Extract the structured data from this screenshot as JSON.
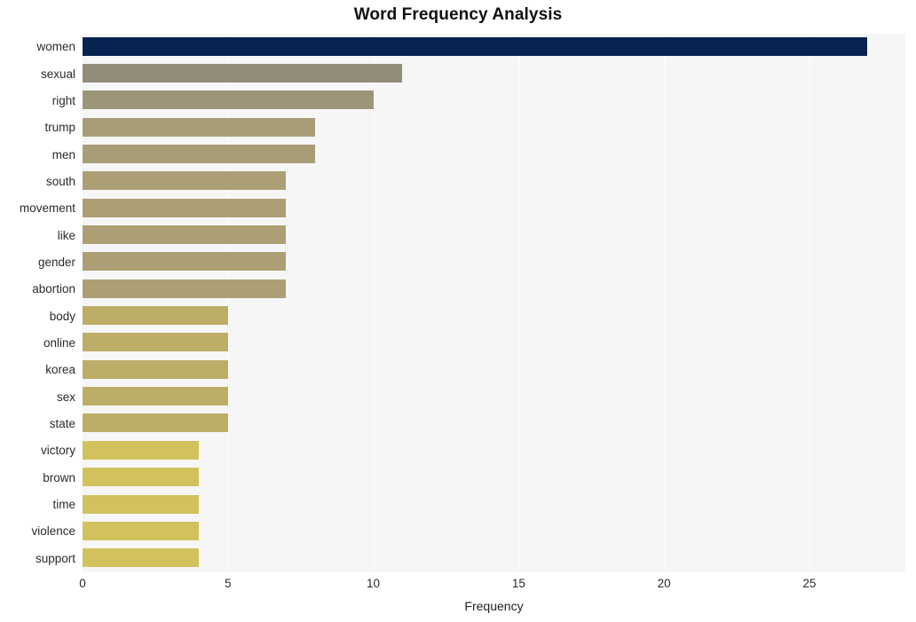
{
  "chart_data": {
    "type": "bar",
    "orientation": "horizontal",
    "title": "Word Frequency Analysis",
    "xlabel": "Frequency",
    "ylabel": "",
    "xlim": [
      0,
      28.3
    ],
    "xticks": [
      0,
      5,
      10,
      15,
      20,
      25
    ],
    "xtick_labels": [
      "0",
      "5",
      "10",
      "15",
      "20",
      "25"
    ],
    "grid": true,
    "grid_axis": "x",
    "legend": "none",
    "plot_background": "#f6f6f7",
    "figure_background": "#ffffff",
    "categories": [
      "women",
      "sexual",
      "right",
      "trump",
      "men",
      "south",
      "movement",
      "like",
      "gender",
      "abortion",
      "body",
      "online",
      "korea",
      "sex",
      "state",
      "victory",
      "brown",
      "time",
      "violence",
      "support"
    ],
    "values": [
      27,
      11,
      10,
      8,
      8,
      7,
      7,
      7,
      7,
      7,
      5,
      5,
      5,
      5,
      5,
      4,
      4,
      4,
      4,
      4
    ],
    "bar_colors": [
      "#06244f",
      "#928d7b",
      "#9c957a",
      "#a89d77",
      "#a89d77",
      "#ad9f75",
      "#ad9f75",
      "#ad9f75",
      "#ad9f75",
      "#ad9f75",
      "#bdae67",
      "#bdae67",
      "#bdae67",
      "#bdae67",
      "#bdae67",
      "#d2c25d",
      "#d2c25d",
      "#d2c25d",
      "#d2c25d",
      "#d2c25d"
    ]
  }
}
